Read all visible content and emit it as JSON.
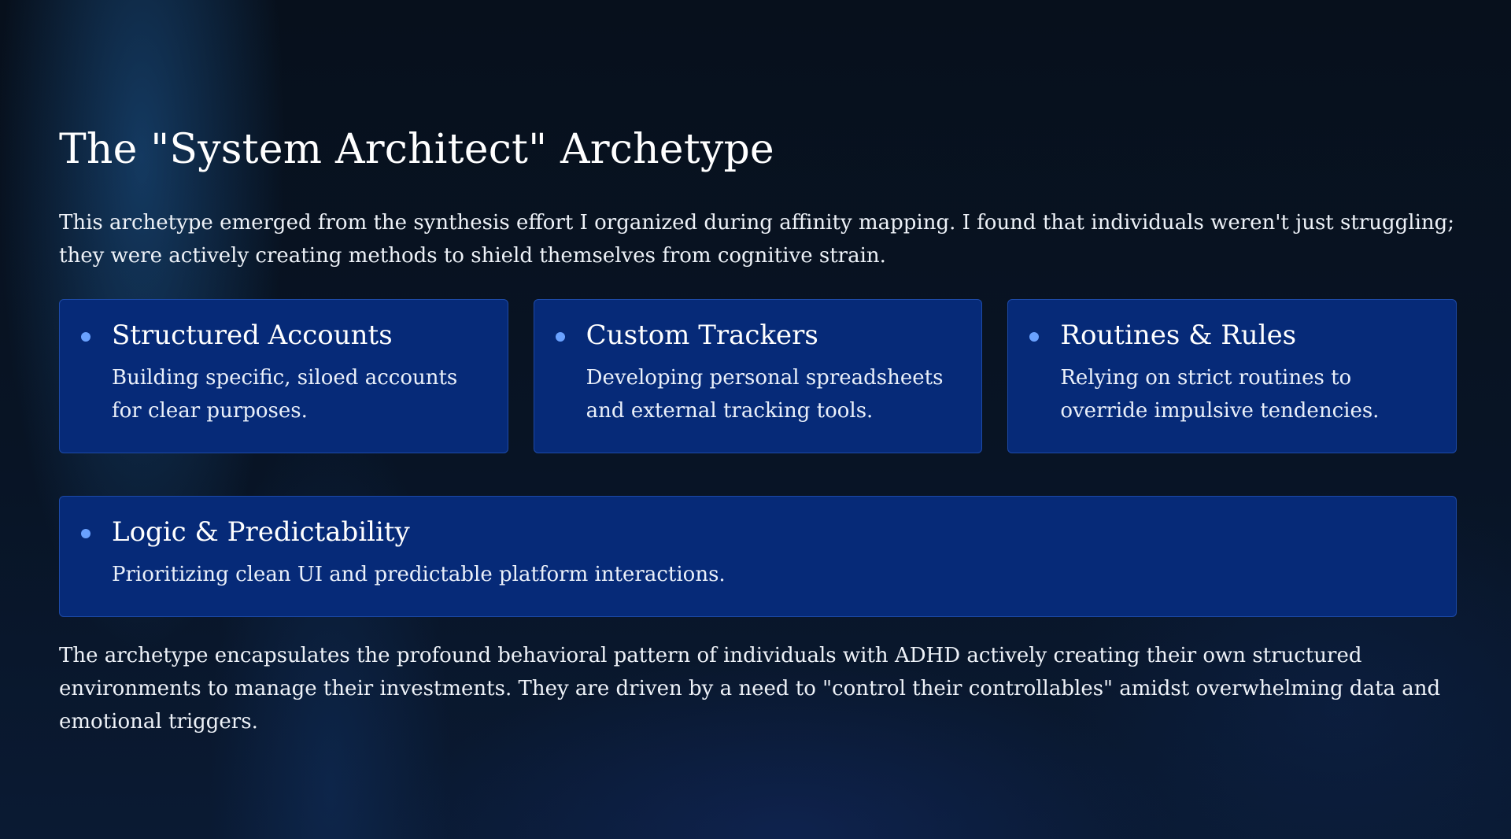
{
  "title": "The \"System Architect\" Archetype",
  "intro": "This archetype emerged from the synthesis effort I organized during affinity mapping. I found that individuals weren't just struggling; they were actively creating methods to shield themselves from cognitive strain.",
  "cards": [
    {
      "title": "Structured Accounts",
      "text": "Building specific, siloed accounts for clear purposes."
    },
    {
      "title": "Custom Trackers",
      "text": "Developing personal spreadsheets and external tracking tools."
    },
    {
      "title": "Routines & Rules",
      "text": "Relying on strict routines to override impulsive tendencies."
    },
    {
      "title": "Logic & Predictability",
      "text": "Prioritizing clean UI and predictable platform interactions."
    }
  ],
  "outro": "The archetype encapsulates the profound behavioral pattern of individuals with ADHD actively creating their own structured environments to manage their investments. They are driven by a need to \"control their controllables\" amidst overwhelming data and emotional triggers.",
  "colors": {
    "background": "#08111f",
    "card": "#062a78",
    "card_border": "#1d4aa8",
    "bullet": "#6aa2ff",
    "text": "#ffffff"
  },
  "icons": {
    "bullet": "bullet-dot-icon"
  }
}
